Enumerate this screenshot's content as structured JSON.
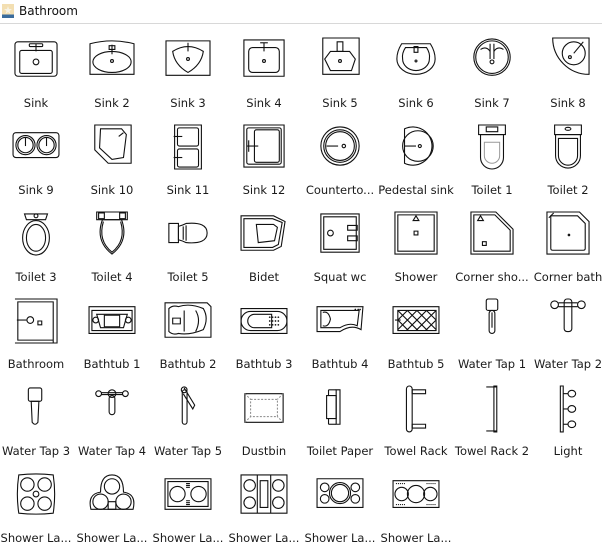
{
  "header": {
    "title": "Bathroom",
    "icon": "library-folder-icon"
  },
  "shapes": [
    {
      "label": "Sink",
      "icon": "sink-icon"
    },
    {
      "label": "Sink 2",
      "icon": "sink-oval-icon"
    },
    {
      "label": "Sink 3",
      "icon": "sink-triangular-icon"
    },
    {
      "label": "Sink 4",
      "icon": "sink-rect-icon"
    },
    {
      "label": "Sink 5",
      "icon": "sink-octagon-icon"
    },
    {
      "label": "Sink 6",
      "icon": "sink-round-icon"
    },
    {
      "label": "Sink 7",
      "icon": "sink-circle-icon"
    },
    {
      "label": "Sink 8",
      "icon": "sink-corner-icon"
    },
    {
      "label": "Sink 9",
      "icon": "double-sink-icon"
    },
    {
      "label": "Sink 10",
      "icon": "sink-pentagon-icon"
    },
    {
      "label": "Sink 11",
      "icon": "double-sink-vertical-icon"
    },
    {
      "label": "Sink 12",
      "icon": "sink-square-icon"
    },
    {
      "label": "Counterto...",
      "icon": "countertop-sink-icon"
    },
    {
      "label": "Pedestal sink",
      "icon": "pedestal-sink-icon"
    },
    {
      "label": "Toilet 1",
      "icon": "toilet-icon"
    },
    {
      "label": "Toilet 2",
      "icon": "toilet-icon"
    },
    {
      "label": "Toilet 3",
      "icon": "toilet-oval-icon"
    },
    {
      "label": "Toilet 4",
      "icon": "toilet-icon"
    },
    {
      "label": "Toilet 5",
      "icon": "toilet-side-icon"
    },
    {
      "label": "Bidet",
      "icon": "bidet-icon"
    },
    {
      "label": "Squat wc",
      "icon": "squat-toilet-icon"
    },
    {
      "label": "Shower",
      "icon": "shower-icon"
    },
    {
      "label": "Corner sho...",
      "icon": "corner-shower-icon"
    },
    {
      "label": "Corner bath",
      "icon": "corner-bath-icon"
    },
    {
      "label": "Bathroom",
      "icon": "bathroom-icon"
    },
    {
      "label": "Bathtub 1",
      "icon": "bathtub-icon"
    },
    {
      "label": "Bathtub 2",
      "icon": "bathtub-curved-icon"
    },
    {
      "label": "Bathtub 3",
      "icon": "bathtub-jacuzzi-icon"
    },
    {
      "label": "Bathtub 4",
      "icon": "bathtub-shaped-icon"
    },
    {
      "label": "Bathtub 5",
      "icon": "bathtub-mat-icon"
    },
    {
      "label": "Water Tap 1",
      "icon": "water-tap-icon"
    },
    {
      "label": "Water Tap 2",
      "icon": "water-tap-dual-icon"
    },
    {
      "label": "Water Tap 3",
      "icon": "water-tap-icon"
    },
    {
      "label": "Water Tap 4",
      "icon": "water-tap-dual-icon"
    },
    {
      "label": "Water Tap 5",
      "icon": "water-tap-lever-icon"
    },
    {
      "label": "Dustbin",
      "icon": "dustbin-icon"
    },
    {
      "label": "Toilet Paper",
      "icon": "toilet-paper-icon"
    },
    {
      "label": "Towel Rack",
      "icon": "towel-rack-icon"
    },
    {
      "label": "Towel Rack 2",
      "icon": "towel-rack-icon"
    },
    {
      "label": "Light",
      "icon": "wall-light-icon"
    },
    {
      "label": "Shower La...",
      "icon": "shower-layout-icon"
    },
    {
      "label": "Shower La...",
      "icon": "shower-layout-icon"
    },
    {
      "label": "Shower La...",
      "icon": "shower-layout-icon"
    },
    {
      "label": "Shower La...",
      "icon": "shower-layout-icon"
    },
    {
      "label": "Shower La...",
      "icon": "shower-layout-icon"
    },
    {
      "label": "Shower La...",
      "icon": "shower-layout-icon"
    }
  ]
}
